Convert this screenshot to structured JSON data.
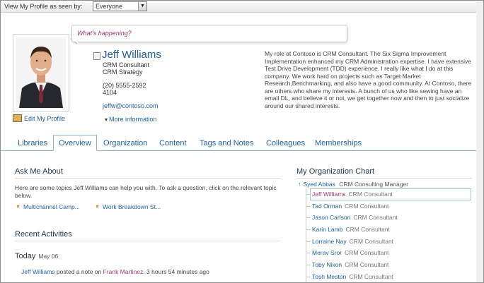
{
  "topbar": {
    "view_label": "View My Profile as seen by:",
    "view_value": "Everyone"
  },
  "status": {
    "placeholder": "What's happening?"
  },
  "profile": {
    "name": "Jeff Williams",
    "title": "CRM Consultant",
    "department": "CRM Strategy",
    "phone_1": "(20) 5555-2592",
    "phone_2": "4104",
    "email": "jeffw@contoso.com",
    "more_info": "More information",
    "edit_profile": "Edit My Profile",
    "about": "My role at Contoso is CRM Consultant. The Six Sigma Improvement Implementation enhanced my CRM Administration expertise. I have extensive Test Drive Development (TDD) experience. I really like what I do at this company. We work hard on projects such as Target Market Research,Benchmarking, and also have a good community. At Contoso, there are others who share my interests. A bunch of us who like sewing have an email DL, and believe it or not, we get together now and then to just socialize around our shared interests."
  },
  "tabs": [
    {
      "label": "Libraries"
    },
    {
      "label": "Overview"
    },
    {
      "label": "Organization"
    },
    {
      "label": "Content"
    },
    {
      "label": "Tags and Notes"
    },
    {
      "label": "Colleagues"
    },
    {
      "label": "Memberships"
    }
  ],
  "ask_me": {
    "title": "Ask Me About",
    "description": "Here are some topics Jeff Williams can help you with. To ask a question, click on the relevant topic below.",
    "topics": [
      "Multichannel Camp...",
      "Work Breakdown St..."
    ]
  },
  "recent": {
    "title": "Recent Activities",
    "day": "Today",
    "date": "May 06",
    "activity_user": "Jeff Williams",
    "activity_text": "posted a note on",
    "activity_target": "Frank Martinez",
    "activity_time": ". 3 hours 54 minutes ago"
  },
  "org_chart": {
    "title": "My Organization Chart",
    "manager": {
      "name": "Syed Abbas",
      "title": "CRM Consulting Manager"
    },
    "members": [
      {
        "name": "Jeff Williams",
        "title": "CRM Consultant"
      },
      {
        "name": "Tad Orman",
        "title": "CRM Consultant"
      },
      {
        "name": "Jason Carlson",
        "title": "CRM Consultant"
      },
      {
        "name": "Karin Lamb",
        "title": "CRM Consultant"
      },
      {
        "name": "Lorraine Nay",
        "title": "CRM Consultant"
      },
      {
        "name": "Merav Sror",
        "title": "CRM Consultant"
      },
      {
        "name": "Toby Nixon",
        "title": "CRM Consultant"
      },
      {
        "name": "Tosh Meston",
        "title": "CRM Consultant"
      }
    ]
  },
  "colors": {
    "link": "#1f5f9e",
    "accent": "#a03774",
    "tab_border": "#8fb2d4"
  }
}
